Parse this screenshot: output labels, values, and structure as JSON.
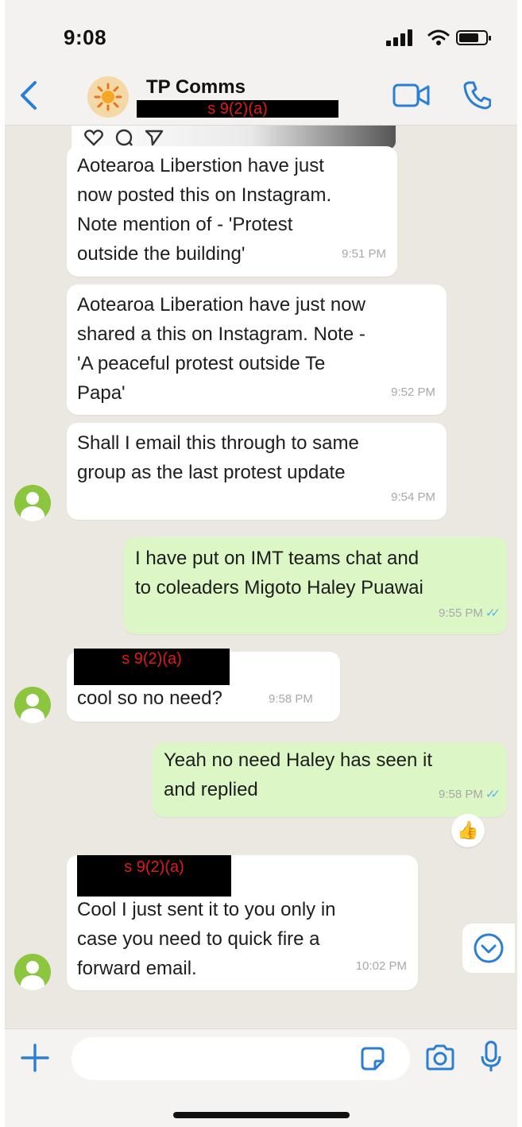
{
  "status_bar": {
    "time": "9:08"
  },
  "header": {
    "chat_title": "TP Comms",
    "redaction": "s 9(2)(a)",
    "icons": {
      "back": "back-chevron-icon",
      "avatar": "sun-group-icon",
      "video": "video-call-icon",
      "call": "phone-call-icon"
    }
  },
  "messages": [
    {
      "id": "m1",
      "direction": "in",
      "text": "Aotearoa Liberstion have just\nnow posted this on Instagram.\nNote mention of - 'Protest\noutside the building'",
      "time": "9:51 PM"
    },
    {
      "id": "m2",
      "direction": "in",
      "text": "Aotearoa Liberation have just now\nshared a this on Instagram. Note -\n'A peaceful protest outside Te\nPapa'",
      "time": "9:52 PM"
    },
    {
      "id": "m3",
      "direction": "in",
      "text": "Shall I email this through to same\ngroup as the last protest update",
      "time": "9:54 PM"
    },
    {
      "id": "m4",
      "direction": "out",
      "text": "I have put on IMT teams chat and\nto coleaders Migoto Haley Puawai",
      "time": "9:55 PM"
    },
    {
      "id": "m5",
      "direction": "in",
      "sender_redaction": "s 9(2)(a)",
      "text": "cool so no need?",
      "time": "9:58 PM"
    },
    {
      "id": "m6",
      "direction": "out",
      "text": "Yeah no need Haley has seen it\nand replied",
      "time": "9:58 PM",
      "reaction": "👍"
    },
    {
      "id": "m7",
      "direction": "in",
      "sender_redaction": "s 9(2)(a)",
      "text": "Cool I just sent it to you only in\ncase you need to quick fire a\nforward email.",
      "time": "10:02 PM"
    }
  ],
  "read_ticks": "✓✓",
  "input": {
    "placeholder": ""
  },
  "colors": {
    "incoming": "#ffffff",
    "outgoing": "#dcf7c5",
    "accent": "#2a7fd4",
    "avatar": "#8cc63f",
    "redaction_text": "#e41a1a"
  }
}
